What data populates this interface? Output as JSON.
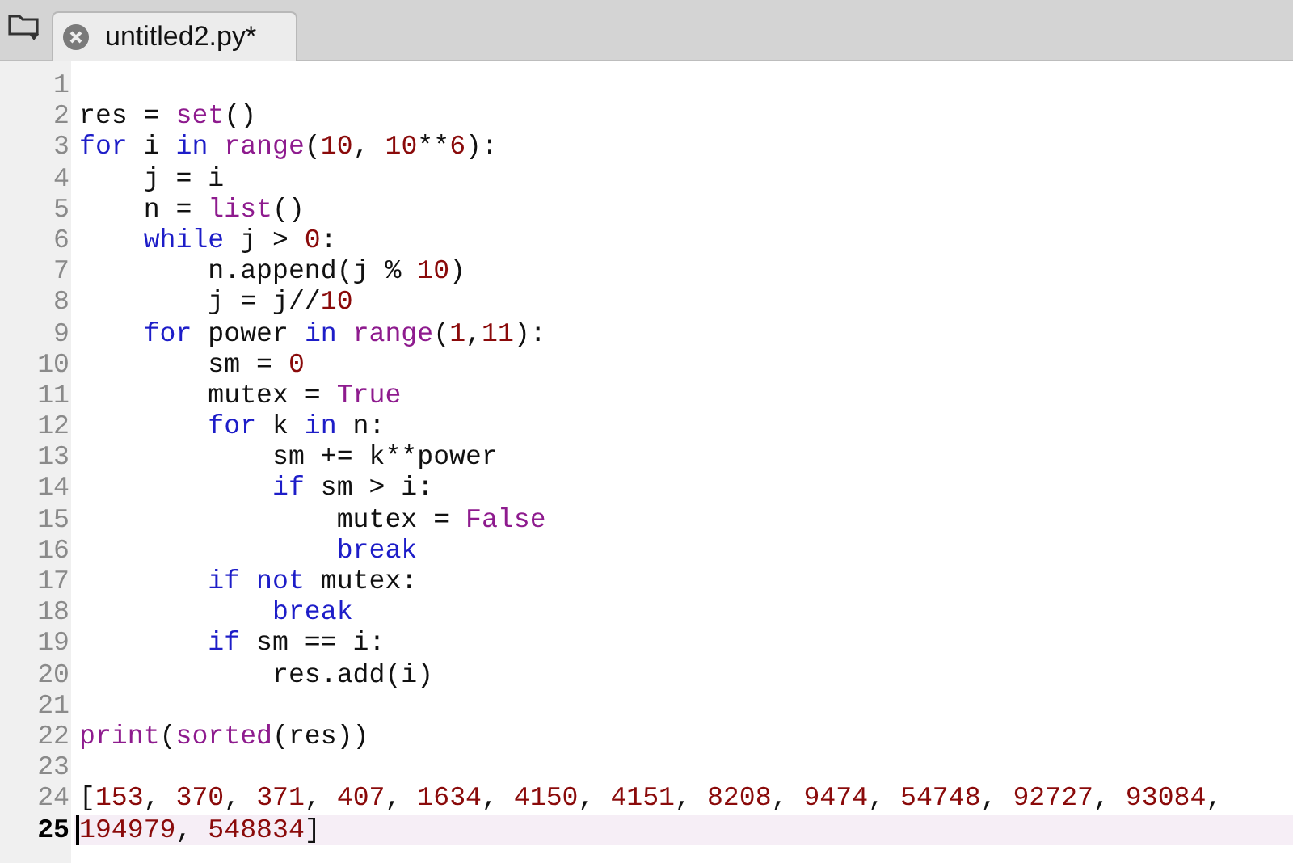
{
  "tab": {
    "title": "untitled2.py*"
  },
  "lines": [
    {
      "number": "1",
      "current": false
    },
    {
      "number": "2",
      "current": false,
      "tokens": [
        {
          "text": "res = ",
          "kind": "plain"
        },
        {
          "text": "set",
          "kind": "builtin"
        },
        {
          "text": "()",
          "kind": "plain"
        }
      ]
    },
    {
      "number": "3",
      "current": false,
      "tokens": [
        {
          "text": "for",
          "kind": "keyword"
        },
        {
          "text": " i ",
          "kind": "plain"
        },
        {
          "text": "in ",
          "kind": "keyword"
        },
        {
          "text": "range",
          "kind": "builtin"
        },
        {
          "text": "(",
          "kind": "plain"
        },
        {
          "text": "10",
          "kind": "number"
        },
        {
          "text": ", ",
          "kind": "plain"
        },
        {
          "text": "10",
          "kind": "number"
        },
        {
          "text": "**",
          "kind": "plain"
        },
        {
          "text": "6",
          "kind": "number"
        },
        {
          "text": "):",
          "kind": "plain"
        }
      ]
    },
    {
      "number": "4",
      "current": false,
      "tokens": [
        {
          "text": "    j = i",
          "kind": "plain"
        }
      ]
    },
    {
      "number": "5",
      "current": false,
      "tokens": [
        {
          "text": "    n = ",
          "kind": "plain"
        },
        {
          "text": "list",
          "kind": "builtin"
        },
        {
          "text": "()",
          "kind": "plain"
        }
      ]
    },
    {
      "number": "6",
      "current": false,
      "tokens": [
        {
          "text": "    while",
          "kind": "keyword"
        },
        {
          "text": " j > ",
          "kind": "plain"
        },
        {
          "text": "0",
          "kind": "number"
        },
        {
          "text": ":",
          "kind": "plain"
        }
      ]
    },
    {
      "number": "7",
      "current": false,
      "tokens": [
        {
          "text": "        n.append(j % ",
          "kind": "plain"
        },
        {
          "text": "10",
          "kind": "number"
        },
        {
          "text": ")",
          "kind": "plain"
        }
      ]
    },
    {
      "number": "8",
      "current": false,
      "tokens": [
        {
          "text": "        j = j//",
          "kind": "plain"
        },
        {
          "text": "10",
          "kind": "number"
        }
      ]
    },
    {
      "number": "9",
      "current": false,
      "tokens": [
        {
          "text": "    for",
          "kind": "keyword"
        },
        {
          "text": " power ",
          "kind": "plain"
        },
        {
          "text": "in ",
          "kind": "keyword"
        },
        {
          "text": "range",
          "kind": "builtin"
        },
        {
          "text": "(",
          "kind": "plain"
        },
        {
          "text": "1",
          "kind": "number"
        },
        {
          "text": ",",
          "kind": "plain"
        },
        {
          "text": "11",
          "kind": "number"
        },
        {
          "text": "):",
          "kind": "plain"
        }
      ]
    },
    {
      "number": "10",
      "current": false,
      "tokens": [
        {
          "text": "        sm = ",
          "kind": "plain"
        },
        {
          "text": "0",
          "kind": "number"
        }
      ]
    },
    {
      "number": "11",
      "current": false,
      "tokens": [
        {
          "text": "        mutex = ",
          "kind": "plain"
        },
        {
          "text": "True",
          "kind": "builtin"
        }
      ]
    },
    {
      "number": "12",
      "current": false,
      "tokens": [
        {
          "text": "        for",
          "kind": "keyword"
        },
        {
          "text": " k ",
          "kind": "plain"
        },
        {
          "text": "in",
          "kind": "keyword"
        },
        {
          "text": " n:",
          "kind": "plain"
        }
      ]
    },
    {
      "number": "13",
      "current": false,
      "tokens": [
        {
          "text": "            sm += k**power",
          "kind": "plain"
        }
      ]
    },
    {
      "number": "14",
      "current": false,
      "tokens": [
        {
          "text": "            if",
          "kind": "keyword"
        },
        {
          "text": " sm > i:",
          "kind": "plain"
        }
      ]
    },
    {
      "number": "15",
      "current": false,
      "tokens": [
        {
          "text": "                mutex = ",
          "kind": "plain"
        },
        {
          "text": "False",
          "kind": "builtin"
        }
      ]
    },
    {
      "number": "16",
      "current": false,
      "tokens": [
        {
          "text": "                break",
          "kind": "keyword"
        }
      ]
    },
    {
      "number": "17",
      "current": false,
      "tokens": [
        {
          "text": "        if not",
          "kind": "keyword"
        },
        {
          "text": " mutex:",
          "kind": "plain"
        }
      ]
    },
    {
      "number": "18",
      "current": false,
      "tokens": [
        {
          "text": "            break",
          "kind": "keyword"
        }
      ]
    },
    {
      "number": "19",
      "current": false,
      "tokens": [
        {
          "text": "        if",
          "kind": "keyword"
        },
        {
          "text": " sm == i:",
          "kind": "plain"
        }
      ]
    },
    {
      "number": "20",
      "current": false,
      "tokens": [
        {
          "text": "            res.add(i)",
          "kind": "plain"
        }
      ]
    },
    {
      "number": "21",
      "current": false
    },
    {
      "number": "22",
      "current": false,
      "tokens": [
        {
          "text": "print",
          "kind": "builtin"
        },
        {
          "text": "(",
          "kind": "plain"
        },
        {
          "text": "sorted",
          "kind": "builtin"
        },
        {
          "text": "(res))",
          "kind": "plain"
        }
      ]
    },
    {
      "number": "23",
      "current": false
    },
    {
      "number": "24",
      "current": false,
      "tokens": [
        {
          "text": "[",
          "kind": "plain"
        },
        {
          "text": "153",
          "kind": "number"
        },
        {
          "text": ", ",
          "kind": "plain"
        },
        {
          "text": "370",
          "kind": "number"
        },
        {
          "text": ", ",
          "kind": "plain"
        },
        {
          "text": "371",
          "kind": "number"
        },
        {
          "text": ", ",
          "kind": "plain"
        },
        {
          "text": "407",
          "kind": "number"
        },
        {
          "text": ", ",
          "kind": "plain"
        },
        {
          "text": "1634",
          "kind": "number"
        },
        {
          "text": ", ",
          "kind": "plain"
        },
        {
          "text": "4150",
          "kind": "number"
        },
        {
          "text": ", ",
          "kind": "plain"
        },
        {
          "text": "4151",
          "kind": "number"
        },
        {
          "text": ", ",
          "kind": "plain"
        },
        {
          "text": "8208",
          "kind": "number"
        },
        {
          "text": ", ",
          "kind": "plain"
        },
        {
          "text": "9474",
          "kind": "number"
        },
        {
          "text": ", ",
          "kind": "plain"
        },
        {
          "text": "54748",
          "kind": "number"
        },
        {
          "text": ", ",
          "kind": "plain"
        },
        {
          "text": "92727",
          "kind": "number"
        },
        {
          "text": ", ",
          "kind": "plain"
        },
        {
          "text": "93084",
          "kind": "number"
        },
        {
          "text": ",",
          "kind": "plain"
        }
      ]
    },
    {
      "number": "25",
      "current": true,
      "tokens": [
        {
          "text": "194979",
          "kind": "number"
        },
        {
          "text": ", ",
          "kind": "plain"
        },
        {
          "text": "548834",
          "kind": "number"
        },
        {
          "text": "]",
          "kind": "plain"
        }
      ]
    }
  ]
}
